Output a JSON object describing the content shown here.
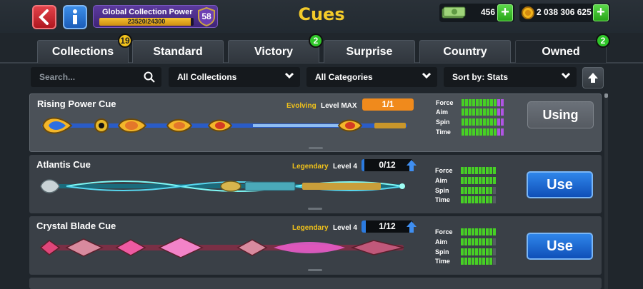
{
  "header": {
    "title": "Cues",
    "collection_power": {
      "label": "Global Collection Power",
      "value_text": "23520/24300",
      "progress": 0.968,
      "level": "58"
    },
    "cash": {
      "value": "456"
    },
    "coins": {
      "value": "2 038 306 625"
    }
  },
  "tabs": [
    {
      "label": "Collections",
      "badge": "19",
      "badge_color": "yellow",
      "active": false
    },
    {
      "label": "Standard",
      "badge": "",
      "active": false
    },
    {
      "label": "Victory",
      "badge": "2",
      "badge_color": "green",
      "active": false
    },
    {
      "label": "Surprise",
      "badge": "",
      "active": false
    },
    {
      "label": "Country",
      "badge": "",
      "active": false
    },
    {
      "label": "Owned",
      "badge": "2",
      "badge_color": "green",
      "active": true
    }
  ],
  "filters": {
    "search_placeholder": "Search...",
    "collection": "All Collections",
    "category": "All Categories",
    "sort": "Sort by: Stats"
  },
  "stat_labels": [
    "Force",
    "Aim",
    "Spin",
    "Time"
  ],
  "cues": [
    {
      "name": "Rising Power Cue",
      "rarity": "Evolving",
      "level": "Level MAX",
      "progress_text": "1/1",
      "progress_fraction": 1.0,
      "progress_color": "#f08a1c",
      "stats": {
        "force": 10,
        "aim": 10,
        "spin": 10,
        "time": 10
      },
      "stats_max": 12,
      "action": "Using",
      "selected": true
    },
    {
      "name": "Atlantis Cue",
      "rarity": "Legendary",
      "level": "Level 4",
      "progress_text": "0/12",
      "progress_fraction": 0.0,
      "progress_color": "#2b7be0",
      "stats": {
        "force": 10,
        "aim": 10,
        "spin": 9,
        "time": 9
      },
      "stats_max": 10,
      "action": "Use",
      "selected": false
    },
    {
      "name": "Crystal Blade Cue",
      "rarity": "Legendary",
      "level": "Level 4",
      "progress_text": "1/12",
      "progress_fraction": 0.083,
      "progress_color": "#2b7be0",
      "stats": {
        "force": 10,
        "aim": 9,
        "spin": 9,
        "time": 9
      },
      "stats_max": 10,
      "action": "Use",
      "selected": false
    }
  ]
}
